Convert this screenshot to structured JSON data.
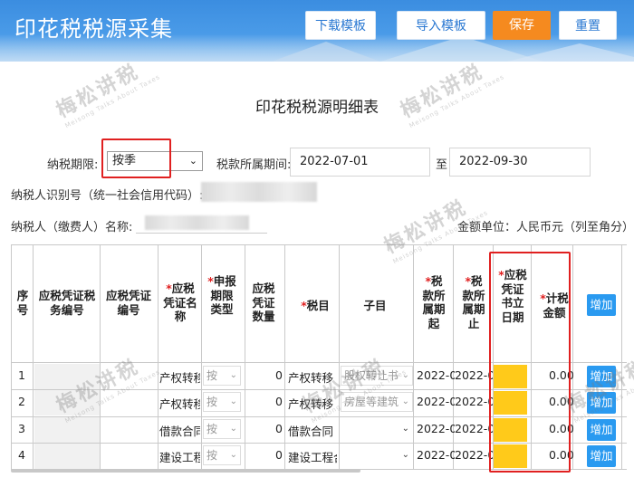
{
  "header": {
    "title": "印花税税源采集",
    "buttons": {
      "download": "下载模板",
      "import": "导入模板",
      "save": "保存",
      "reset": "重置"
    },
    "colors": {
      "bar": "#4a9be8",
      "save": "#f58a1f"
    }
  },
  "sheet": {
    "title": "印花税税源明细表"
  },
  "form": {
    "period_label": "纳税期限:",
    "period_value": "按季",
    "range_label": "税款所属期间:",
    "start_date": "2022-07-01",
    "to_label": "至",
    "end_date": "2022-09-30",
    "taxpayer_id_label": "纳税人识别号（统一社会信用代码）:",
    "taxpayer_name_label": "纳税人（缴费人）名称:",
    "currency_label": "金额单位：人民币元（列至角分）"
  },
  "table": {
    "headers": {
      "seq": "序号",
      "tax_doc_no": "应税凭证税务编号",
      "doc_no": "应税凭证编号",
      "doc_name": "应税凭证名称",
      "period_type": "申报期限类型",
      "doc_qty": "应税凭证数量",
      "tax_item": "税目",
      "sub_item": "子目",
      "period_start": "税款所属期起",
      "period_end": "税款所属期止",
      "doc_date": "应税凭证书立日期",
      "taxable_amount": "计税金额",
      "add": "增加"
    },
    "rows": [
      {
        "seq": "1",
        "doc_name": "产权转移",
        "period_type": "按",
        "qty": "0",
        "tax_item": "产权转移",
        "sub_item": "股权转让书",
        "start": "2022-0",
        "end": "2022-0",
        "amount": "0.00",
        "add": "增加"
      },
      {
        "seq": "2",
        "doc_name": "产权转移",
        "period_type": "按",
        "qty": "0",
        "tax_item": "产权转移",
        "sub_item": "房屋等建筑",
        "start": "2022-0",
        "end": "2022-0",
        "amount": "0.00",
        "add": "增加"
      },
      {
        "seq": "3",
        "doc_name": "借款合同",
        "period_type": "按",
        "qty": "0",
        "tax_item": "借款合同",
        "sub_item": "",
        "start": "2022-0",
        "end": "2022-0",
        "amount": "0.00",
        "add": "增加"
      },
      {
        "seq": "4",
        "doc_name": "建设工程",
        "period_type": "按",
        "qty": "0",
        "tax_item": "建设工程合",
        "sub_item": "",
        "start": "2022-0",
        "end": "2022-0",
        "amount": "0.00",
        "add": "增加"
      }
    ]
  },
  "watermark": {
    "text": "梅松讲税",
    "sub": "Meisong Talks About Taxes"
  }
}
